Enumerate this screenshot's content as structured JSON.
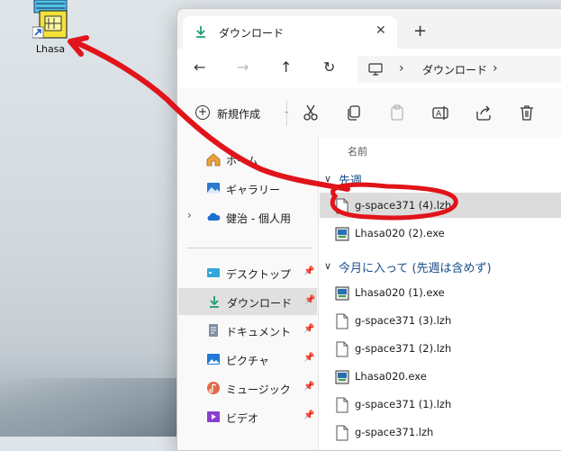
{
  "desktop": {
    "icon_label": "Lhasa"
  },
  "window": {
    "tab_title": "ダウンロード",
    "tab_close": "✕",
    "new_tab": "+",
    "nav": {
      "back": "←",
      "forward": "→",
      "up": "↑",
      "refresh": "↻"
    },
    "address": {
      "separator": "›",
      "crumb": "ダウンロード"
    },
    "toolbar": {
      "new_label": "新規作成",
      "new_caret": "⌄",
      "icons": [
        "cut-icon",
        "copy-icon",
        "paste-icon",
        "rename-icon",
        "share-icon",
        "delete-icon"
      ]
    }
  },
  "sidebar": {
    "items": [
      {
        "label": "ホーム",
        "icon": "home-icon"
      },
      {
        "label": "ギャラリー",
        "icon": "gallery-icon"
      },
      {
        "label": "健治 - 個人用",
        "icon": "onedrive-icon",
        "expand": "›"
      }
    ],
    "pinned": [
      {
        "label": "デスクトップ",
        "icon": "desktop-icon",
        "pin": "📌"
      },
      {
        "label": "ダウンロード",
        "icon": "download-icon",
        "pin": "📌",
        "selected": true
      },
      {
        "label": "ドキュメント",
        "icon": "documents-icon",
        "pin": "📌"
      },
      {
        "label": "ピクチャ",
        "icon": "pictures-icon",
        "pin": "📌"
      },
      {
        "label": "ミュージック",
        "icon": "music-icon",
        "pin": "📌"
      },
      {
        "label": "ビデオ",
        "icon": "videos-icon",
        "pin": "📌"
      }
    ]
  },
  "content": {
    "column_header": "名前",
    "groups": [
      {
        "label": "先週",
        "chevron": "∨"
      },
      {
        "label": "今月に入って (先週は含めず)",
        "chevron": "∨"
      }
    ],
    "files_last_week": [
      {
        "name": "g-space371 (4).lzh",
        "type": "lzh",
        "selected": true
      },
      {
        "name": "Lhasa020 (2).exe",
        "type": "exe"
      }
    ],
    "files_this_month": [
      {
        "name": "Lhasa020 (1).exe",
        "type": "exe"
      },
      {
        "name": "g-space371 (3).lzh",
        "type": "lzh"
      },
      {
        "name": "g-space371 (2).lzh",
        "type": "lzh"
      },
      {
        "name": "Lhasa020.exe",
        "type": "exe"
      },
      {
        "name": "g-space371 (1).lzh",
        "type": "lzh"
      },
      {
        "name": "g-space371.lzh",
        "type": "lzh"
      }
    ]
  },
  "colors": {
    "annotation_red": "#e0141a",
    "download_green": "#1f9e6e",
    "group_blue": "#1a4f8a",
    "selection_gray": "#dcdcdc"
  }
}
